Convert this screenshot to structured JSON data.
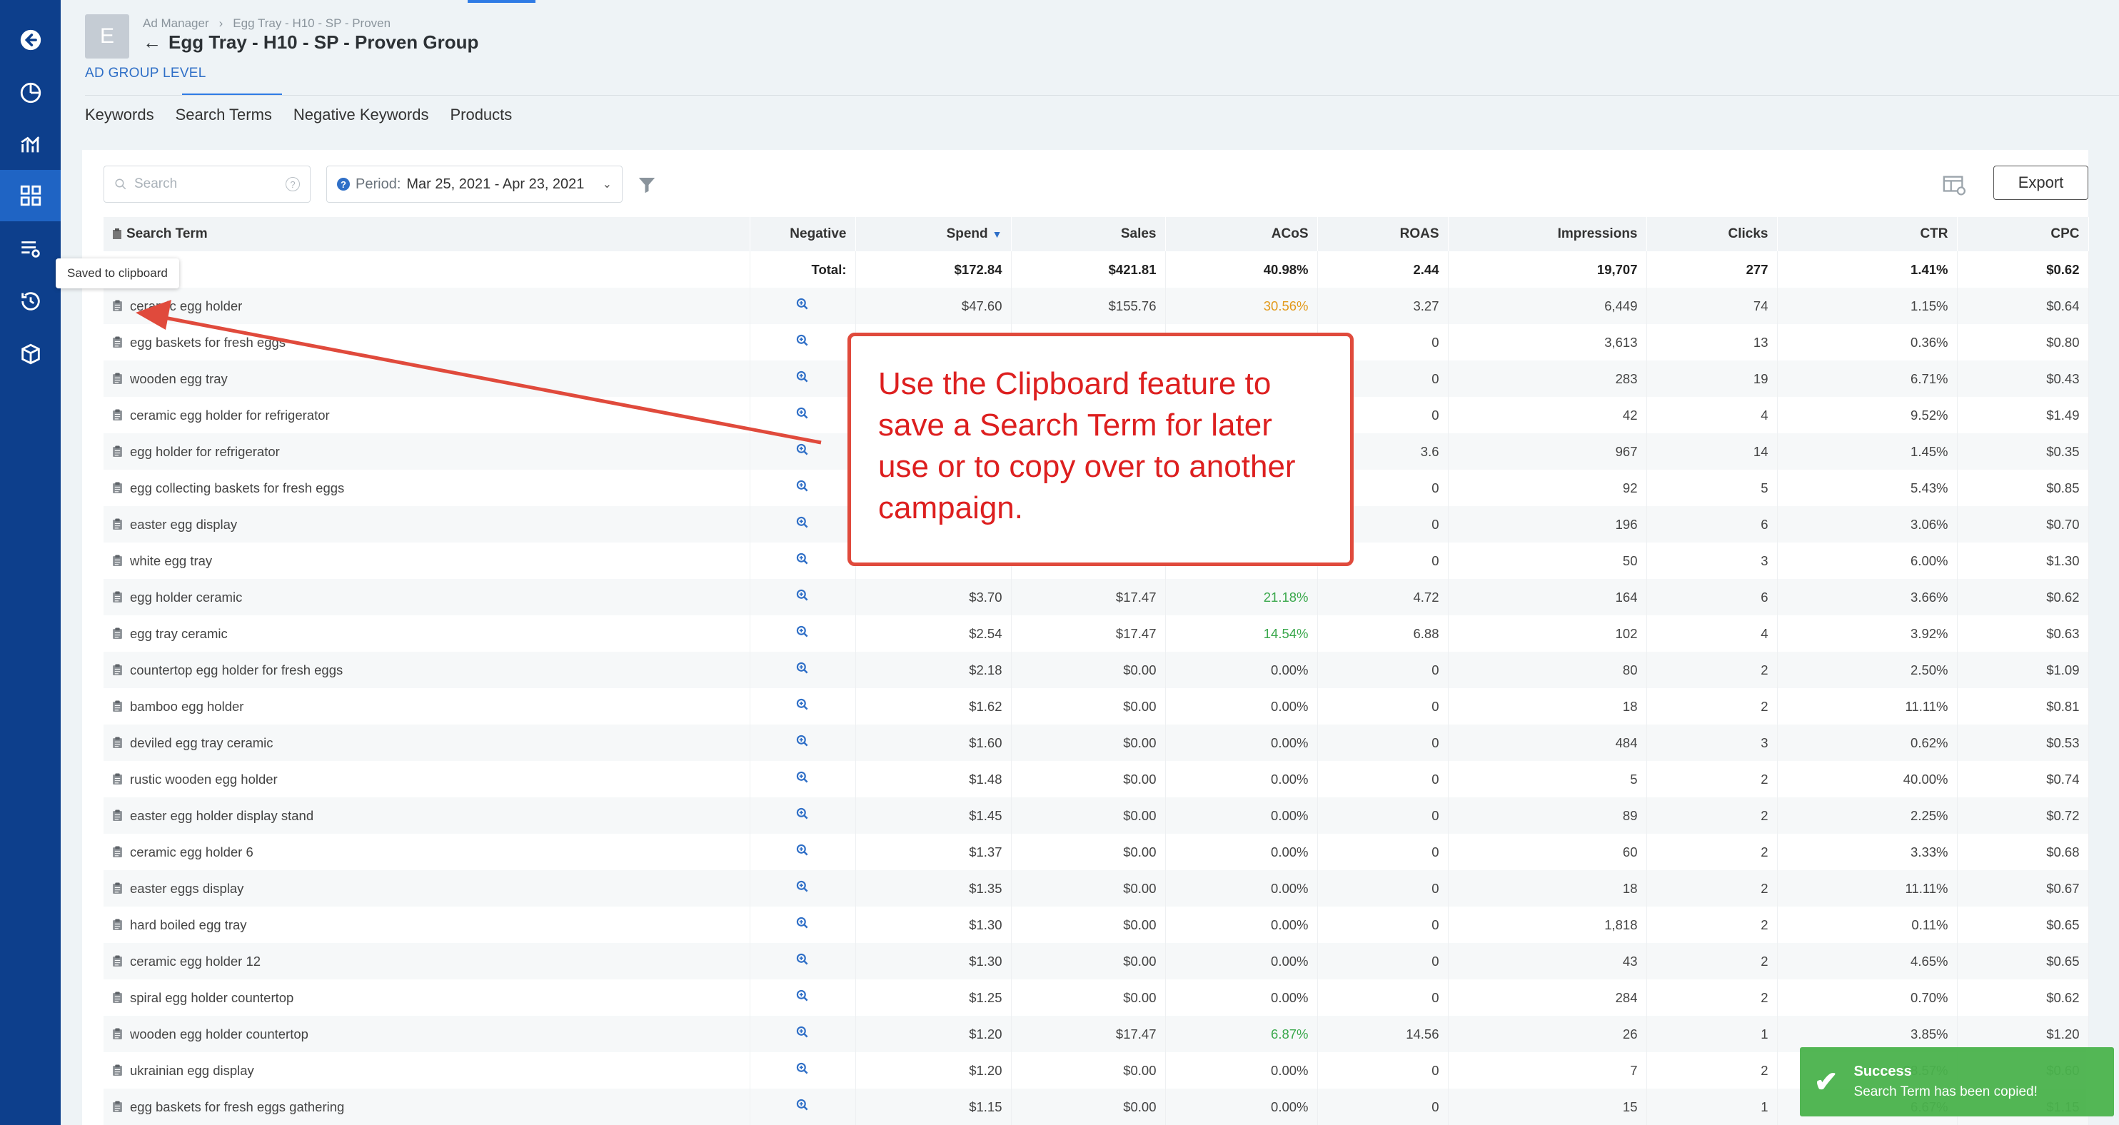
{
  "header": {
    "avatar_letter": "E",
    "breadcrumb": [
      "Ad Manager",
      "›",
      "Egg Tray - H10 - SP - Proven"
    ],
    "title": "Egg Tray - H10 - SP - Proven Group",
    "level_label": "AD GROUP LEVEL",
    "tabs": [
      {
        "label": "Keywords"
      },
      {
        "label": "Search Terms"
      },
      {
        "label": "Negative Keywords"
      },
      {
        "label": "Products"
      }
    ]
  },
  "toolbar": {
    "search_placeholder": "Search",
    "period_label": "Period:",
    "period_value": "Mar 25, 2021 - Apr 23, 2021",
    "export_label": "Export"
  },
  "table": {
    "columns": [
      "Search Term",
      "Negative",
      "Spend",
      "Sales",
      "ACoS",
      "ROAS",
      "Impressions",
      "Clicks",
      "CTR",
      "CPC"
    ],
    "total_label": "Total:",
    "totals": {
      "spend": "$172.84",
      "sales": "$421.81",
      "acos": "40.98%",
      "roas": "2.44",
      "impressions": "19,707",
      "clicks": "277",
      "ctr": "1.41%",
      "cpc": "$0.62"
    },
    "rows": [
      {
        "term": "ceramic egg holder",
        "spend": "$47.60",
        "sales": "$155.76",
        "acos": "30.56%",
        "acos_color": "orange",
        "roas": "3.27",
        "impressions": "6,449",
        "clicks": "74",
        "ctr": "1.15%",
        "cpc": "$0.64"
      },
      {
        "term": "egg baskets for fresh eggs",
        "spend": "",
        "sales": "",
        "acos": "",
        "acos_color": "",
        "roas": "0",
        "impressions": "3,613",
        "clicks": "13",
        "ctr": "0.36%",
        "cpc": "$0.80"
      },
      {
        "term": "wooden egg tray",
        "spend": "",
        "sales": "",
        "acos": "",
        "acos_color": "",
        "roas": "0",
        "impressions": "283",
        "clicks": "19",
        "ctr": "6.71%",
        "cpc": "$0.43"
      },
      {
        "term": "ceramic egg holder for refrigerator",
        "spend": "",
        "sales": "",
        "acos": "",
        "acos_color": "",
        "roas": "0",
        "impressions": "42",
        "clicks": "4",
        "ctr": "9.52%",
        "cpc": "$1.49"
      },
      {
        "term": "egg holder for refrigerator",
        "spend": "",
        "sales": "",
        "acos": "",
        "acos_color": "",
        "roas": "3.6",
        "impressions": "967",
        "clicks": "14",
        "ctr": "1.45%",
        "cpc": "$0.35"
      },
      {
        "term": "egg collecting baskets for fresh eggs",
        "spend": "",
        "sales": "",
        "acos": "",
        "acos_color": "",
        "roas": "0",
        "impressions": "92",
        "clicks": "5",
        "ctr": "5.43%",
        "cpc": "$0.85"
      },
      {
        "term": "easter egg display",
        "spend": "",
        "sales": "",
        "acos": "",
        "acos_color": "",
        "roas": "0",
        "impressions": "196",
        "clicks": "6",
        "ctr": "3.06%",
        "cpc": "$0.70"
      },
      {
        "term": "white egg tray",
        "spend": "",
        "sales": "",
        "acos": "",
        "acos_color": "",
        "roas": "0",
        "impressions": "50",
        "clicks": "3",
        "ctr": "6.00%",
        "cpc": "$1.30"
      },
      {
        "term": "egg holder ceramic",
        "spend": "$3.70",
        "sales": "$17.47",
        "acos": "21.18%",
        "acos_color": "green",
        "roas": "4.72",
        "impressions": "164",
        "clicks": "6",
        "ctr": "3.66%",
        "cpc": "$0.62"
      },
      {
        "term": "egg tray ceramic",
        "spend": "$2.54",
        "sales": "$17.47",
        "acos": "14.54%",
        "acos_color": "green",
        "roas": "6.88",
        "impressions": "102",
        "clicks": "4",
        "ctr": "3.92%",
        "cpc": "$0.63"
      },
      {
        "term": "countertop egg holder for fresh eggs",
        "spend": "$2.18",
        "sales": "$0.00",
        "acos": "0.00%",
        "acos_color": "",
        "roas": "0",
        "impressions": "80",
        "clicks": "2",
        "ctr": "2.50%",
        "cpc": "$1.09"
      },
      {
        "term": "bamboo egg holder",
        "spend": "$1.62",
        "sales": "$0.00",
        "acos": "0.00%",
        "acos_color": "",
        "roas": "0",
        "impressions": "18",
        "clicks": "2",
        "ctr": "11.11%",
        "cpc": "$0.81"
      },
      {
        "term": "deviled egg tray ceramic",
        "spend": "$1.60",
        "sales": "$0.00",
        "acos": "0.00%",
        "acos_color": "",
        "roas": "0",
        "impressions": "484",
        "clicks": "3",
        "ctr": "0.62%",
        "cpc": "$0.53"
      },
      {
        "term": "rustic wooden egg holder",
        "spend": "$1.48",
        "sales": "$0.00",
        "acos": "0.00%",
        "acos_color": "",
        "roas": "0",
        "impressions": "5",
        "clicks": "2",
        "ctr": "40.00%",
        "cpc": "$0.74"
      },
      {
        "term": "easter egg holder display stand",
        "spend": "$1.45",
        "sales": "$0.00",
        "acos": "0.00%",
        "acos_color": "",
        "roas": "0",
        "impressions": "89",
        "clicks": "2",
        "ctr": "2.25%",
        "cpc": "$0.72"
      },
      {
        "term": "ceramic egg holder 6",
        "spend": "$1.37",
        "sales": "$0.00",
        "acos": "0.00%",
        "acos_color": "",
        "roas": "0",
        "impressions": "60",
        "clicks": "2",
        "ctr": "3.33%",
        "cpc": "$0.68"
      },
      {
        "term": "easter eggs display",
        "spend": "$1.35",
        "sales": "$0.00",
        "acos": "0.00%",
        "acos_color": "",
        "roas": "0",
        "impressions": "18",
        "clicks": "2",
        "ctr": "11.11%",
        "cpc": "$0.67"
      },
      {
        "term": "hard boiled egg tray",
        "spend": "$1.30",
        "sales": "$0.00",
        "acos": "0.00%",
        "acos_color": "",
        "roas": "0",
        "impressions": "1,818",
        "clicks": "2",
        "ctr": "0.11%",
        "cpc": "$0.65"
      },
      {
        "term": "ceramic egg holder 12",
        "spend": "$1.30",
        "sales": "$0.00",
        "acos": "0.00%",
        "acos_color": "",
        "roas": "0",
        "impressions": "43",
        "clicks": "2",
        "ctr": "4.65%",
        "cpc": "$0.65"
      },
      {
        "term": "spiral egg holder countertop",
        "spend": "$1.25",
        "sales": "$0.00",
        "acos": "0.00%",
        "acos_color": "",
        "roas": "0",
        "impressions": "284",
        "clicks": "2",
        "ctr": "0.70%",
        "cpc": "$0.62"
      },
      {
        "term": "wooden egg holder countertop",
        "spend": "$1.20",
        "sales": "$17.47",
        "acos": "6.87%",
        "acos_color": "green",
        "roas": "14.56",
        "impressions": "26",
        "clicks": "1",
        "ctr": "3.85%",
        "cpc": "$1.20"
      },
      {
        "term": "ukrainian egg display",
        "spend": "$1.20",
        "sales": "$0.00",
        "acos": "0.00%",
        "acos_color": "",
        "roas": "0",
        "impressions": "7",
        "clicks": "2",
        "ctr": "28.57%",
        "cpc": "$0.60"
      },
      {
        "term": "egg baskets for fresh eggs gathering",
        "spend": "$1.15",
        "sales": "$0.00",
        "acos": "0.00%",
        "acos_color": "",
        "roas": "0",
        "impressions": "15",
        "clicks": "1",
        "ctr": "6.67%",
        "cpc": "$1.15"
      }
    ]
  },
  "tooltip": {
    "text": "Saved to clipboard"
  },
  "annotation": {
    "text": "Use the Clipboard feature to save a Search Term for later use or to copy over to another campaign."
  },
  "toast": {
    "title": "Success",
    "message": "Search Term has been copied!"
  },
  "icons": [
    "back-arrow-icon",
    "dashboard-icon",
    "analytics-icon",
    "grid-icon",
    "list-settings-icon",
    "history-icon",
    "box-icon",
    "search-icon",
    "help-icon",
    "info-icon",
    "chevron-down-icon",
    "filter-icon",
    "columns-settings-icon",
    "clipboard-icon",
    "magnify-icon",
    "check-icon"
  ],
  "colors": {
    "sidebar": "#0d3f8c",
    "sidebar_active": "#1f64c4",
    "accent": "#2f6fc7",
    "acos_orange": "#e29a1b",
    "acos_green": "#3aa84c",
    "callout_red": "#dd1f1f",
    "toast_green": "#4ab34c"
  }
}
